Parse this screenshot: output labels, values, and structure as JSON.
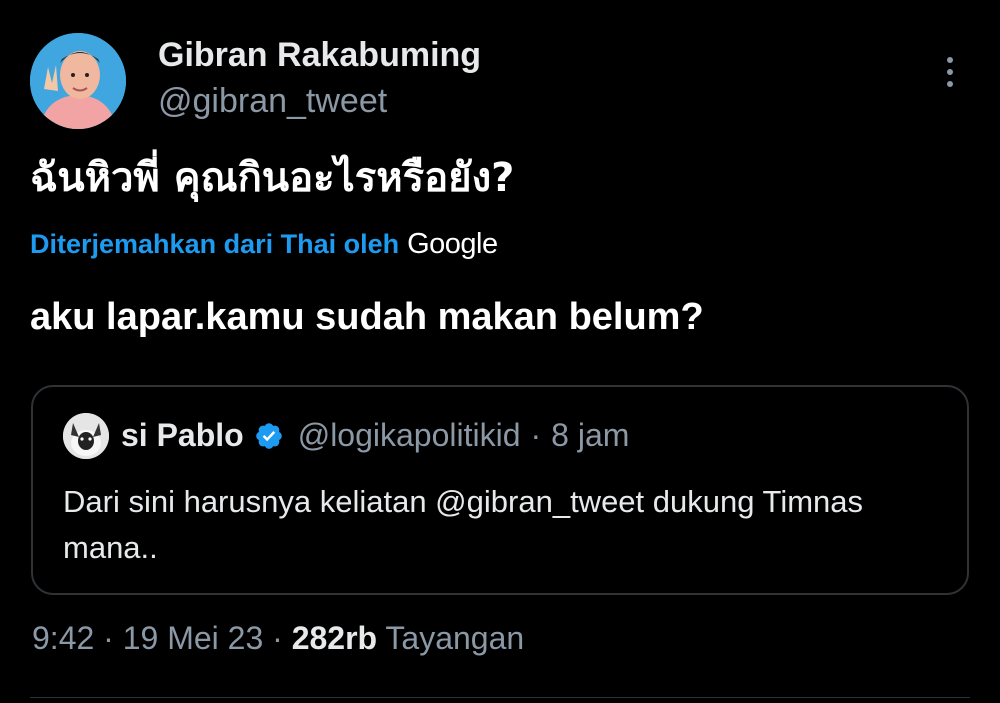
{
  "author": {
    "name": "Gibran Rakabuming",
    "handle": "@gibran_tweet",
    "avatar_icon": "user-avatar"
  },
  "tweet": {
    "original_text": "ฉันหิวพี่ คุณกินอะไรหรือยัง?",
    "translate_label": "Diterjemahkan dari Thai oleh",
    "translator": "Google",
    "translated_text": "aku lapar.kamu sudah makan belum?"
  },
  "quoted_tweet": {
    "name": "si Pablo",
    "verified": true,
    "handle": "@logikapolitikid",
    "separator": "·",
    "time": "8 jam",
    "text": "Dari sini harusnya keliatan @gibran_tweet dukung Timnas mana.."
  },
  "meta": {
    "time": "9:42",
    "sep1": "·",
    "date": "19 Mei 23",
    "sep2": "·",
    "views_count": "282rb",
    "views_label": "Tayangan"
  },
  "colors": {
    "background": "#000000",
    "link": "#1d9bf0",
    "secondary_text": "#8b98a5",
    "border": "#2f3336",
    "verified": "#1d9bf0"
  }
}
